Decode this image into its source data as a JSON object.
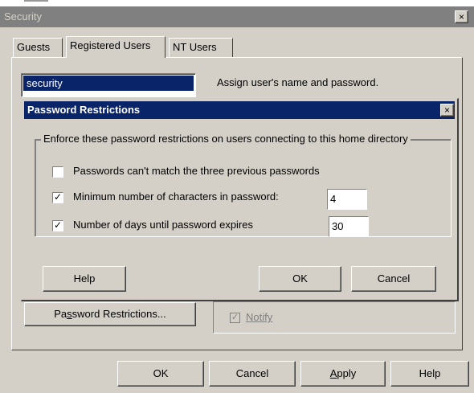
{
  "security_window": {
    "title": "Security",
    "close_glyph": "×",
    "tabs": [
      "Guests",
      "Registered Users",
      "NT Users"
    ],
    "active_tab": "Registered Users",
    "users": [
      "security"
    ],
    "user_description": "Assign user's name and password.",
    "password_restrictions_button": {
      "prefix": "Pa",
      "underlined": "s",
      "suffix": "sword Restrictions..."
    },
    "notify": {
      "label": "Notify",
      "checked": true,
      "enabled": false
    },
    "buttons": {
      "ok": "OK",
      "cancel": "Cancel",
      "apply": "Apply",
      "help": "Help"
    }
  },
  "password_dialog": {
    "title": "Password Restrictions",
    "close_glyph": "×",
    "group_label": "Enforce these password restrictions on users connecting to this home directory",
    "options": [
      {
        "label": "Passwords can't match the three previous passwords",
        "checked": false,
        "value": ""
      },
      {
        "label": "Minimum number of characters in password:",
        "checked": true,
        "value": "4"
      },
      {
        "label": "Number of days until password expires",
        "checked": true,
        "value": "30"
      }
    ],
    "buttons": {
      "help": "Help",
      "ok": "OK",
      "cancel": "Cancel"
    }
  },
  "colors": {
    "dialog_face": "#d4d0c8",
    "active_title": "#0a246a",
    "inactive_title": "#808080",
    "selection": "#0a246a"
  }
}
